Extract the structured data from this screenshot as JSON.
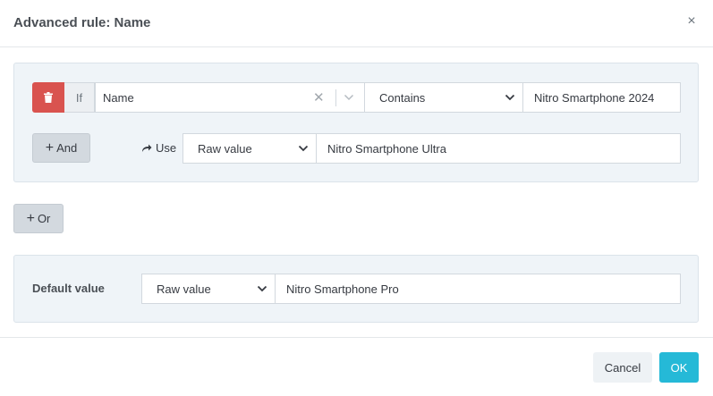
{
  "header": {
    "title": "Advanced rule: Name",
    "close_label": "×"
  },
  "rule": {
    "if_label": "If",
    "field_value": "Name",
    "clear_label": "✕",
    "operator_value": "Contains",
    "match_value": "Nitro Smartphone 2024",
    "and_label": "And",
    "use_label": "Use",
    "use_type_value": "Raw value",
    "use_value": "Nitro Smartphone Ultra"
  },
  "or_label": "Or",
  "default": {
    "label": "Default value",
    "type_value": "Raw value",
    "value": "Nitro Smartphone Pro"
  },
  "footer": {
    "cancel_label": "Cancel",
    "ok_label": "OK"
  },
  "colors": {
    "danger": "#d9534f",
    "primary": "#25b9d7",
    "panel_bg": "#eff4f8"
  }
}
